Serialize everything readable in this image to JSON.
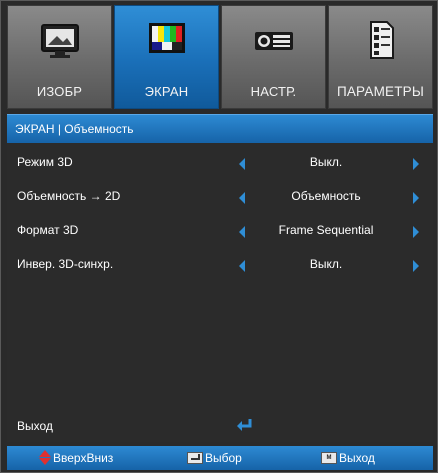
{
  "tabs": [
    {
      "label": "ИЗОБР",
      "icon": "picture-icon",
      "active": false
    },
    {
      "label": "ЭКРАН",
      "icon": "screen-icon",
      "active": true
    },
    {
      "label": "НАСТР.",
      "icon": "projector-icon",
      "active": false
    },
    {
      "label": "ПАРАМЕТРЫ",
      "icon": "options-icon",
      "active": false
    }
  ],
  "header": {
    "title": "ЭКРАН | Объемность"
  },
  "settings": [
    {
      "label": "Режим 3D",
      "value": "Выкл."
    },
    {
      "label": "Объемность → 2D",
      "value": "Объемность"
    },
    {
      "label": "Формат 3D",
      "value": "Frame Sequential"
    },
    {
      "label": "Инвер. 3D-синхр.",
      "value": "Выкл."
    }
  ],
  "exit": {
    "label": "Выход"
  },
  "footer": {
    "updown": "ВверхВниз",
    "select": "Выбор",
    "exit": "Выход"
  },
  "colors": {
    "accent": "#1a6fb8",
    "arrow": "#2f8ed6",
    "updown": "#e03030"
  }
}
